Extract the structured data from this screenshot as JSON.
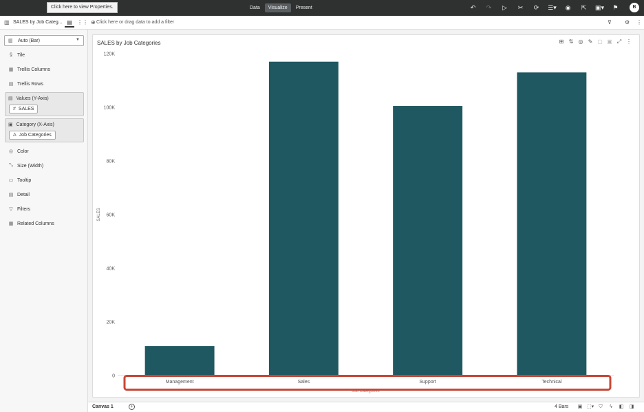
{
  "topbar": {
    "tooltip": "Click here to view Properties.",
    "tabs": [
      "Data",
      "Visualize",
      "Present"
    ],
    "active_tab": "Visualize",
    "icons": [
      "undo-icon",
      "redo-icon",
      "play-icon",
      "tools-icon",
      "refresh-data-icon",
      "comments-icon",
      "insights-icon",
      "export-icon",
      "save-icon",
      "bookmark-icon"
    ],
    "user_initial": "B"
  },
  "left_panel": {
    "title": "SALES by Job Categ...",
    "chart_type": "Auto (Bar)",
    "grammar": {
      "tile": "Tile",
      "trellis_columns": "Trellis Columns",
      "trellis_rows": "Trellis Rows",
      "values_label": "Values (Y-Axis)",
      "values_pill": "SALES",
      "values_pill_glyph": "#",
      "category_label": "Category (X-Axis)",
      "category_pill": "Job Categories",
      "category_pill_glyph": "A",
      "color": "Color",
      "size": "Size (Width)",
      "tooltip": "Tooltip",
      "detail": "Detail",
      "filters": "Filters",
      "related_columns": "Related Columns"
    }
  },
  "filter_bar": {
    "placeholder": "Click here or drag data to add a filter"
  },
  "viz": {
    "title": "SALES by Job Categories",
    "tools": [
      "data-actions-icon",
      "sort-icon",
      "color-icon",
      "edit-icon",
      "copy-icon",
      "expand-icon",
      "more-icon"
    ]
  },
  "chart_data": {
    "type": "bar",
    "categories": [
      "Management",
      "Sales",
      "Support",
      "Technical"
    ],
    "values": [
      11000,
      117000,
      100500,
      113000
    ],
    "ylabel": "SALES",
    "xlabel": "Job Categories",
    "ylim": [
      0,
      120000
    ],
    "yticks": [
      "0",
      "20K",
      "40K",
      "60K",
      "80K",
      "100K",
      "120K"
    ],
    "bar_color": "#1f5861",
    "highlight_color": "#c74634",
    "grid": false
  },
  "bottom_bar": {
    "canvas_tab": "Canvas 1",
    "bar_count": "4 Bars"
  }
}
